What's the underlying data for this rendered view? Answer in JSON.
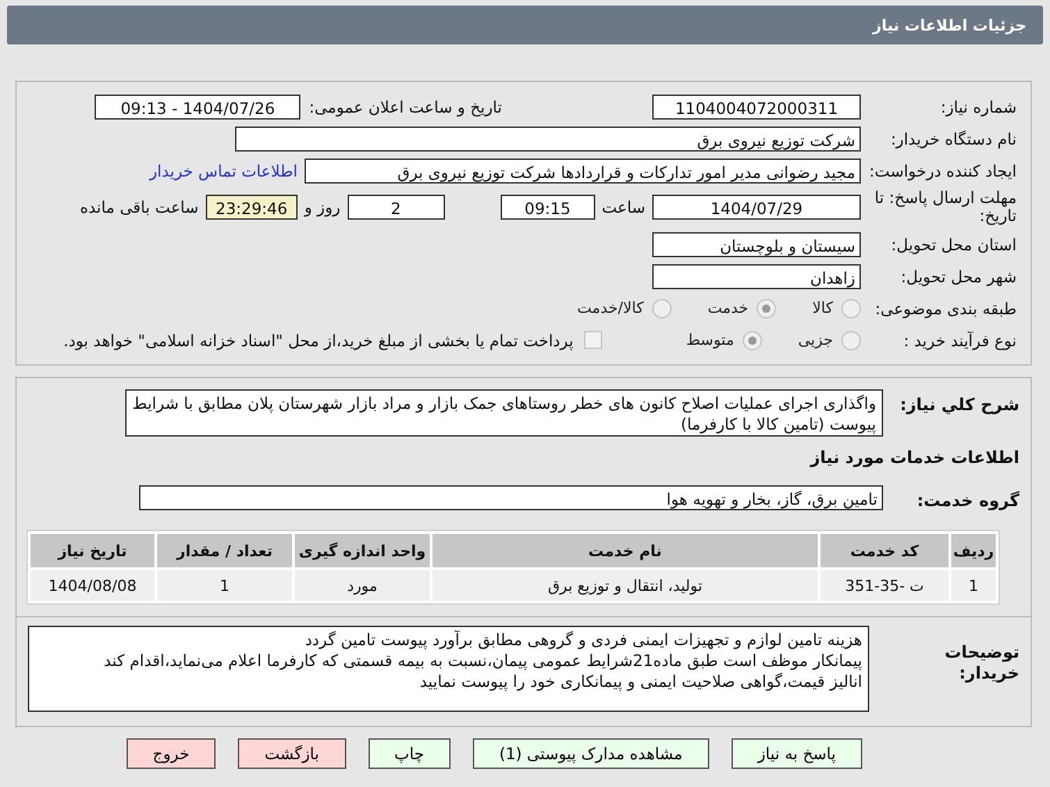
{
  "header": {
    "title": "جزئیات اطلاعات نیاز"
  },
  "need_number": {
    "label": "شماره نیاز:",
    "value": "1104004072000311"
  },
  "announce": {
    "label": "تاریخ و ساعت اعلان عمومی:",
    "value": "1404/07/26 - 09:13"
  },
  "buyer": {
    "label": "نام دستگاه خریدار:",
    "value": "شرکت توزیع نیروی برق"
  },
  "creator": {
    "label": "ایجاد کننده درخواست:",
    "value": "مجید  رضوانی مدیر امور تدارکات و قراردادها شرکت توزیع نیروی برق",
    "link": "اطلاعات تماس خریدار"
  },
  "deadline": {
    "label": "مهلت ارسال پاسخ: تا تاریخ:",
    "date": "1404/07/29",
    "time_label": "ساعت",
    "time": "09:15",
    "days": "2",
    "days_label": "روز و",
    "remaining": "23:29:46",
    "remaining_label": "ساعت باقی مانده"
  },
  "province": {
    "label": "استان محل تحویل:",
    "value": "سیستان و بلوچستان"
  },
  "city": {
    "label": "شهر محل تحویل:",
    "value": "زاهدان"
  },
  "category": {
    "label": "طبقه بندی موضوعی:",
    "options": [
      {
        "label": "کالا",
        "selected": false
      },
      {
        "label": "خدمت",
        "selected": true
      },
      {
        "label": "کالا/خدمت",
        "selected": false
      }
    ]
  },
  "process": {
    "label": "نوع فرآیند خرید :",
    "options": [
      {
        "label": "جزیی",
        "selected": false
      },
      {
        "label": "متوسط",
        "selected": true
      }
    ],
    "treasury": {
      "label": "پرداخت تمام یا بخشی از مبلغ خرید،از محل \"اسناد خزانه اسلامی\" خواهد بود.",
      "checked": false
    }
  },
  "description": {
    "label": "شرح کلي نیاز:",
    "value": "واگذاری اجرای عملیات اصلاح کانون های خطر روستاهای جمک بازار و مراد بازار شهرستان پلان مطابق با شرایط پیوست (تامین کالا با کارفرما)"
  },
  "services_heading": "اطلاعات خدمات مورد نیاز",
  "service_group": {
    "label": "گروه خدمت:",
    "value": "تامین برق، گاز، بخار و تهویه هوا"
  },
  "table": {
    "columns": [
      "ردیف",
      "کد خدمت",
      "نام خدمت",
      "واحد اندازه گیری",
      "تعداد / مقدار",
      "تاریخ نیاز"
    ],
    "rows": [
      [
        "1",
        "ت -35-351",
        "تولید، انتقال و توزیع برق",
        "مورد",
        "1",
        "1404/08/08"
      ]
    ]
  },
  "buyer_notes": {
    "label": "توضیحات خریدار:",
    "lines": [
      "هزینه تامین لوازم و تجهیزات ایمنی فردی و گروهی مطابق برآورد پیوست تامین گردد",
      "پیمانکار موظف است طبق ماده21شرایط عمومی پیمان،نسبت به بیمه قسمتی که کارفرما اعلام می‌نماید،اقدام کند",
      "انالیز قیمت،گواهی صلاحیت ایمنی و پیمانکاری خود را پیوست نمایید"
    ]
  },
  "buttons": [
    {
      "label": "پاسخ به نیاز",
      "color": "#eaffea"
    },
    {
      "label": "مشاهده مدارک پیوستی (1)",
      "color": "#eaffea"
    },
    {
      "label": "چاپ",
      "color": "#eaffea"
    },
    {
      "label": "بازگشت",
      "color": "#ffd6d6"
    },
    {
      "label": "خروج",
      "color": "#ffd6d6"
    }
  ]
}
